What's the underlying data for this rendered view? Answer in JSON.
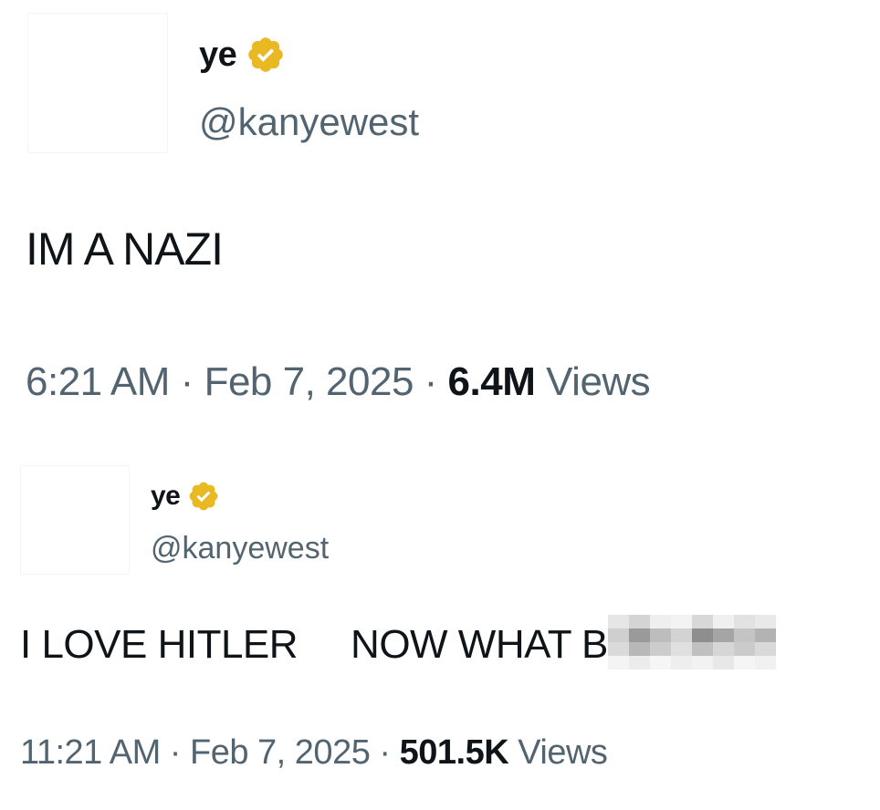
{
  "tweets": [
    {
      "display_name": "ye",
      "verified_icon": "gold-verified-badge-icon",
      "handle": "@kanyewest",
      "text": "IM A NAZI",
      "time": "6:21 AM",
      "separator": "·",
      "date": "Feb 7, 2025",
      "views_count": "6.4M",
      "views_label": "Views"
    },
    {
      "display_name": "ye",
      "verified_icon": "gold-verified-badge-icon",
      "handle": "@kanyewest",
      "text_part1": "I LOVE HITLER",
      "text_part2": "NOW WHAT B",
      "redaction": "pixelated-blur",
      "time": "11:21 AM",
      "separator": "·",
      "date": "Feb 7, 2025",
      "views_count": "501.5K",
      "views_label": "Views"
    }
  ],
  "colors": {
    "text_primary": "#0f1419",
    "text_secondary": "#536471",
    "badge_gold": "#e8b923",
    "background": "#ffffff"
  }
}
